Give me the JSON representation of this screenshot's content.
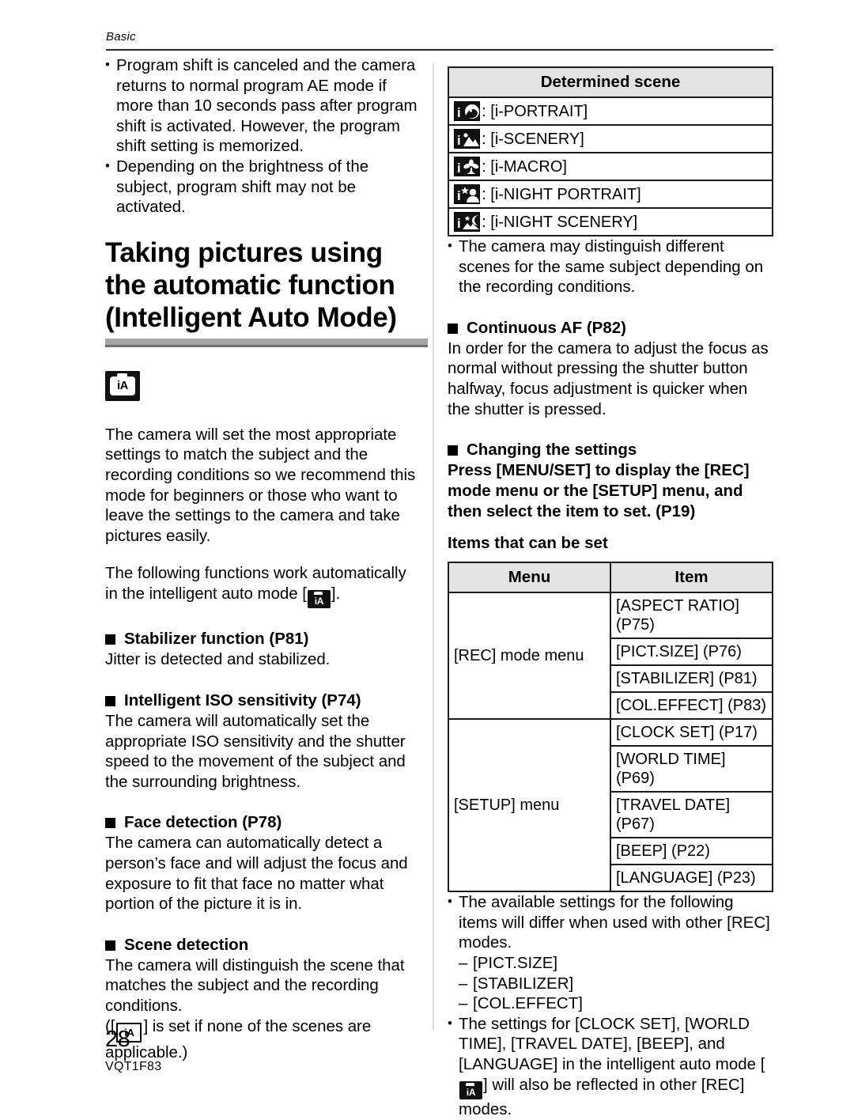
{
  "header": {
    "running_head": "Basic"
  },
  "footer": {
    "page_number": "28",
    "doc_code": "VQT1F83"
  },
  "left_column": {
    "intro_bullets": [
      "Program shift is canceled and the camera returns to normal program AE mode if more than 10 seconds pass after program shift is activated. However, the program shift setting is memorized.",
      "Depending on the brightness of the subject, program shift may not be activated."
    ],
    "section_heading": "Taking pictures using the automatic function (Intelligent Auto Mode)",
    "mode_badge_label": "iA",
    "para_1": "The camera will set the most appropriate settings to match the subject and the recording conditions so we recommend this mode for beginners or those who want to leave the settings to the camera and take pictures easily.",
    "para_2_before": "The following functions work automatically in the intelligent auto mode [",
    "para_2_after": "].",
    "sub_1_heading": "Stabilizer function (P81)",
    "sub_1_body": "Jitter is detected and stabilized.",
    "sub_2_heading": "Intelligent ISO sensitivity (P74)",
    "sub_2_body": "The camera will automatically set the appropriate ISO sensitivity and the shutter speed to the movement of the subject and the surrounding brightness.",
    "sub_3_heading": "Face detection (P78)",
    "sub_3_body": "The camera can automatically detect a person’s face and will adjust the focus and exposure to fit that face no matter what portion of the picture it is in.",
    "sub_4_heading": "Scene detection",
    "sub_4_body": "The camera will distinguish the scene that matches the subject and the recording conditions.",
    "sub_4_note_before": "([",
    "sub_4_note_after": "] is set if none of the scenes are applicable.)"
  },
  "right_column": {
    "scene_table": {
      "header": "Determined scene",
      "rows": [
        {
          "icon": "i-portrait-icon",
          "separator": ":",
          "label": "[i-PORTRAIT]"
        },
        {
          "icon": "i-scenery-icon",
          "separator": ":",
          "label": "[i-SCENERY]"
        },
        {
          "icon": "i-macro-icon",
          "separator": ":",
          "label": "[i-MACRO]"
        },
        {
          "icon": "i-night-portrait-icon",
          "separator": ":",
          "label": "[i-NIGHT PORTRAIT]"
        },
        {
          "icon": "i-night-scenery-icon",
          "separator": ":",
          "label": "[i-NIGHT SCENERY]"
        }
      ]
    },
    "note_bullet": "The camera may distinguish different scenes for the same subject depending on the recording conditions.",
    "sub_1_heading": "Continuous AF (P82)",
    "sub_1_body": "In order for the camera to adjust the focus as normal without pressing the shutter button halfway, focus adjustment is quicker when the shutter is pressed.",
    "sub_2_heading": "Changing the settings",
    "sub_2_bold_body": "Press [MENU/SET] to display the [REC] mode menu or the [SETUP] menu, and then select the item to set. (P19)",
    "items_label": "Items that can be set",
    "menu_table": {
      "headers": [
        "Menu",
        "Item"
      ],
      "groups": [
        {
          "menu": "[REC] mode menu",
          "items": [
            "[ASPECT RATIO] (P75)",
            "[PICT.SIZE] (P76)",
            "[STABILIZER] (P81)",
            "[COL.EFFECT] (P83)"
          ]
        },
        {
          "menu": "[SETUP] menu",
          "items": [
            "[CLOCK SET] (P17)",
            "[WORLD TIME] (P69)",
            "[TRAVEL DATE] (P67)",
            "[BEEP] (P22)",
            "[LANGUAGE] (P23)"
          ]
        }
      ]
    },
    "bottom_bullet_1": "The available settings for the following items will differ when used with other [REC] modes.",
    "bottom_dashes": [
      "[PICT.SIZE]",
      "[STABILIZER]",
      "[COL.EFFECT]"
    ],
    "bottom_bullet_2_before": "The settings for [CLOCK SET], [WORLD TIME], [TRAVEL DATE], [BEEP], and [LANGUAGE] in the intelligent auto mode [",
    "bottom_bullet_2_after": "] will also be reflected in other [REC] modes."
  },
  "colors": {
    "rule": "#2b2b2b",
    "heading_bar": "#a6a6a6",
    "table_header_bg": "#e3e3e3",
    "divider": "#d9d9d9"
  }
}
